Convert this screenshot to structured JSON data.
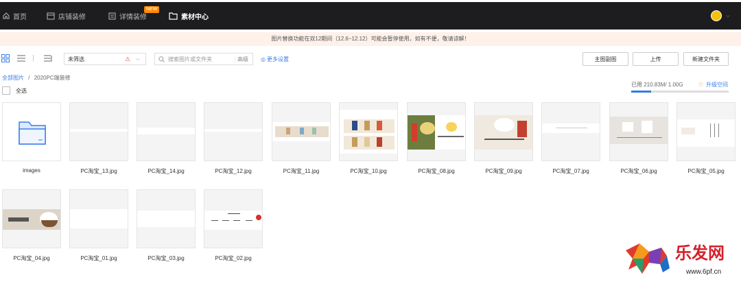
{
  "nav": {
    "items": [
      {
        "label": "首页",
        "icon": "home-icon"
      },
      {
        "label": "店铺装修",
        "icon": "store-icon"
      },
      {
        "label": "详情装修",
        "icon": "document-icon",
        "badge": "NEW"
      },
      {
        "label": "素材中心",
        "icon": "folder-icon",
        "active": true
      }
    ],
    "avatar": "user-avatar"
  },
  "notice": "图片替换功能在双12期间（12.6~12.12）可能会暂停使用，如有不便，敬请谅解！",
  "toolbar": {
    "filter_value": "未筛选",
    "search_placeholder": "搜索图片或文件夹",
    "search_mode": "高级",
    "more_settings": "更多设置",
    "btn_main_image": "主图副图",
    "btn_upload": "上传",
    "btn_new_folder": "新建文件夹"
  },
  "breadcrumb": {
    "root": "全部图片",
    "sep": "/",
    "current": "2020PC端装修"
  },
  "select_all": "全选",
  "storage": {
    "used_text": "已用 210.83M/ 1.00G",
    "upgrade": "升级空间",
    "used_fraction": 0.206
  },
  "files": [
    {
      "name": "images",
      "type": "folder"
    },
    {
      "name": "PC淘宝_13.jpg",
      "type": "image"
    },
    {
      "name": "PC淘宝_14.jpg",
      "type": "image"
    },
    {
      "name": "PC淘宝_12.jpg",
      "type": "image"
    },
    {
      "name": "PC淘宝_11.jpg",
      "type": "image"
    },
    {
      "name": "PC淘宝_10.jpg",
      "type": "image"
    },
    {
      "name": "PC淘宝_08.jpg",
      "type": "image"
    },
    {
      "name": "PC淘宝_09.jpg",
      "type": "image"
    },
    {
      "name": "PC淘宝_07.jpg",
      "type": "image"
    },
    {
      "name": "PC淘宝_06.jpg",
      "type": "image"
    },
    {
      "name": "PC淘宝_05.jpg",
      "type": "image"
    },
    {
      "name": "PC淘宝_04.jpg",
      "type": "image"
    },
    {
      "name": "PC淘宝_01.jpg",
      "type": "image"
    },
    {
      "name": "PC淘宝_03.jpg",
      "type": "image"
    },
    {
      "name": "PC淘宝_02.jpg",
      "type": "image"
    }
  ],
  "watermark": {
    "brand": "乐发网",
    "url": "www.6pf.cn"
  },
  "colors": {
    "nav_bg": "#1d1d1f",
    "notice_bg": "#fdf1ea",
    "accent": "#3b7de9",
    "badge": "#ff8a00"
  }
}
